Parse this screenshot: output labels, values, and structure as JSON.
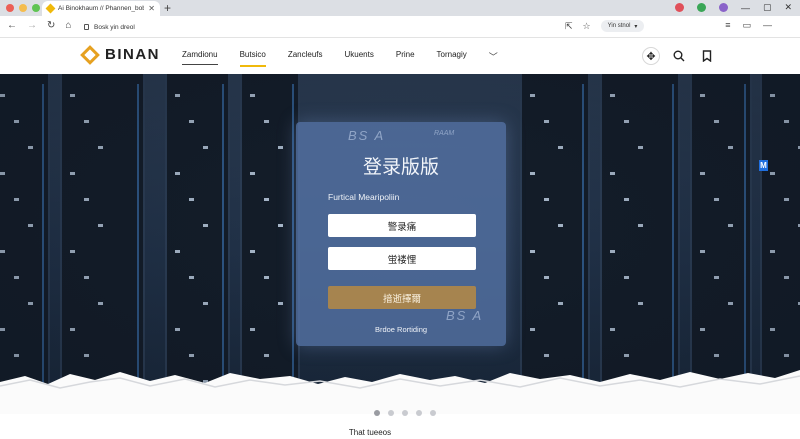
{
  "browser": {
    "tab_title": "Ai Binokhaum // Phannen_bobyn",
    "url": "Bosk yin dreol",
    "profile_label": "Yin stnol"
  },
  "site": {
    "logo_text": "BINAN",
    "nav": [
      {
        "label": "Zamdionu"
      },
      {
        "label": "Butsico"
      },
      {
        "label": "Zancleufs"
      },
      {
        "label": "Ukuents"
      },
      {
        "label": "Prine"
      },
      {
        "label": "Tornagiy"
      }
    ]
  },
  "hero": {
    "card_watermark_top": "BS A",
    "card_watermark_small": "RAAM",
    "card_watermark_bottom": "BS A",
    "card_title": "登录版版",
    "card_subtitle": "Furtical Mearipoliin",
    "button_1": "警录痛",
    "button_2": "蛍褛悝",
    "button_3": "揞逝擇爾",
    "card_footer": "Brdoe Rortiding",
    "side_badge": "M"
  },
  "pager": {
    "count": 5,
    "active": 0
  },
  "section": {
    "title": "That tueeos"
  },
  "colors": {
    "accent": "#f0b90b",
    "gold_button": "#a6844f",
    "card": "#5674a8"
  }
}
